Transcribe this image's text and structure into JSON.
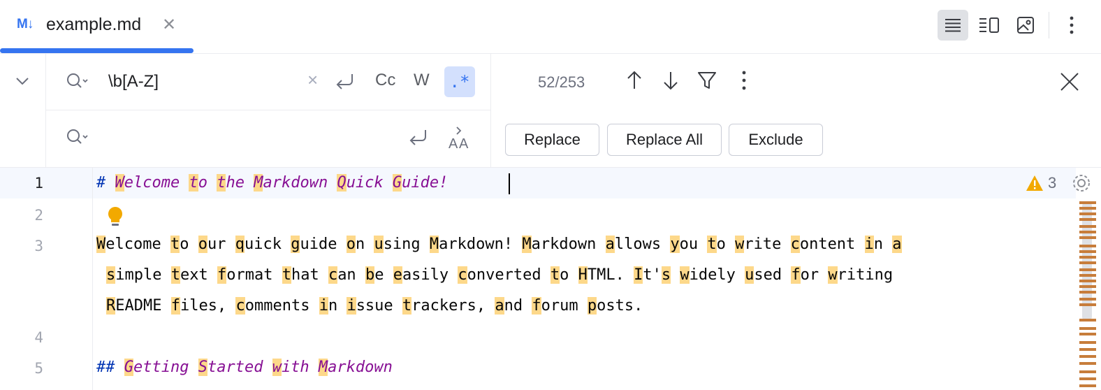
{
  "tab": {
    "icon_text": "M↓",
    "title": "example.md",
    "close_icon": "close-icon"
  },
  "toolbar": {
    "view_modes": [
      "editor-only-icon",
      "editor-and-preview-icon",
      "preview-only-icon"
    ],
    "more_icon": "more-vertical-icon"
  },
  "find": {
    "search_value": "\\b[A-Z]",
    "clear_glyph": "×",
    "match_case_label": "Cc",
    "words_label": "W",
    "regex_label": ".*",
    "replace_value": "",
    "match_count": "52/253"
  },
  "replace_buttons": {
    "replace": "Replace",
    "replace_all": "Replace All",
    "exclude": "Exclude"
  },
  "editor": {
    "line_numbers": [
      "1",
      "2",
      "3",
      "4",
      "5"
    ],
    "warning_count": "3",
    "lines": [
      "# Welcome to the Markdown Quick Guide!",
      "",
      "Welcome to our quick guide on using Markdown! Markdown allows you to write content in a",
      "simple text format that can be easily converted to HTML. It's widely used for writing",
      "README files, comments in issue trackers, and forum posts.",
      "",
      "## Getting Started with Markdown"
    ]
  },
  "colors": {
    "accent": "#3574f0",
    "match_highlight": "#fdd88a",
    "heading": "#871094",
    "hash": "#0033b3",
    "warning": "#f2a900"
  }
}
